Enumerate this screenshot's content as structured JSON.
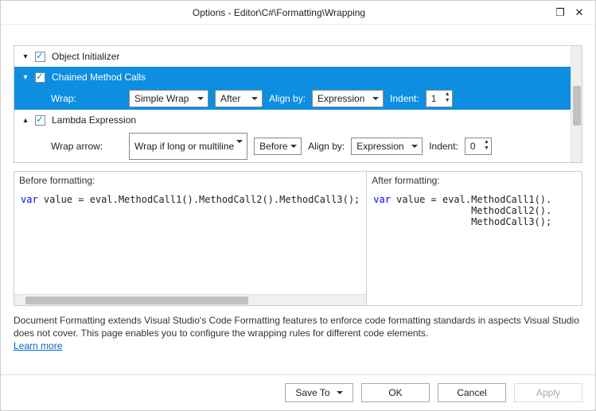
{
  "window": {
    "title": "Options - Editor\\C#\\Formatting\\Wrapping"
  },
  "tree": {
    "item0": {
      "label": "Object Initializer"
    },
    "item1": {
      "label": "Chained Method Calls",
      "wrap_label": "Wrap:",
      "wrap_value": "Simple Wrap",
      "position_value": "After",
      "align_label": "Align by:",
      "align_value": "Expression",
      "indent_label": "Indent:",
      "indent_value": "1"
    },
    "item2": {
      "label": "Lambda Expression",
      "wrap_label": "Wrap arrow:",
      "wrap_value": "Wrap if long or multiline",
      "position_value": "Before",
      "align_label": "Align by:",
      "align_value": "Expression",
      "indent_label": "Indent:",
      "indent_value": "0"
    }
  },
  "preview": {
    "before_header": "Before formatting:",
    "after_header": "After formatting:",
    "before_kw": "var",
    "before_rest": " value = eval.MethodCall1().MethodCall2().MethodCall3();",
    "after_kw": "var",
    "after_l1": " value = eval.MethodCall1().",
    "after_l2": "                 MethodCall2().",
    "after_l3": "                 MethodCall3();"
  },
  "description": {
    "text": "Document Formatting extends Visual Studio's Code Formatting features to enforce code formatting standards in aspects Visual Studio does not cover. This page enables you to configure the wrapping rules for different code elements.",
    "link": "Learn more"
  },
  "buttons": {
    "save_to": "Save To",
    "ok": "OK",
    "cancel": "Cancel",
    "apply": "Apply"
  }
}
